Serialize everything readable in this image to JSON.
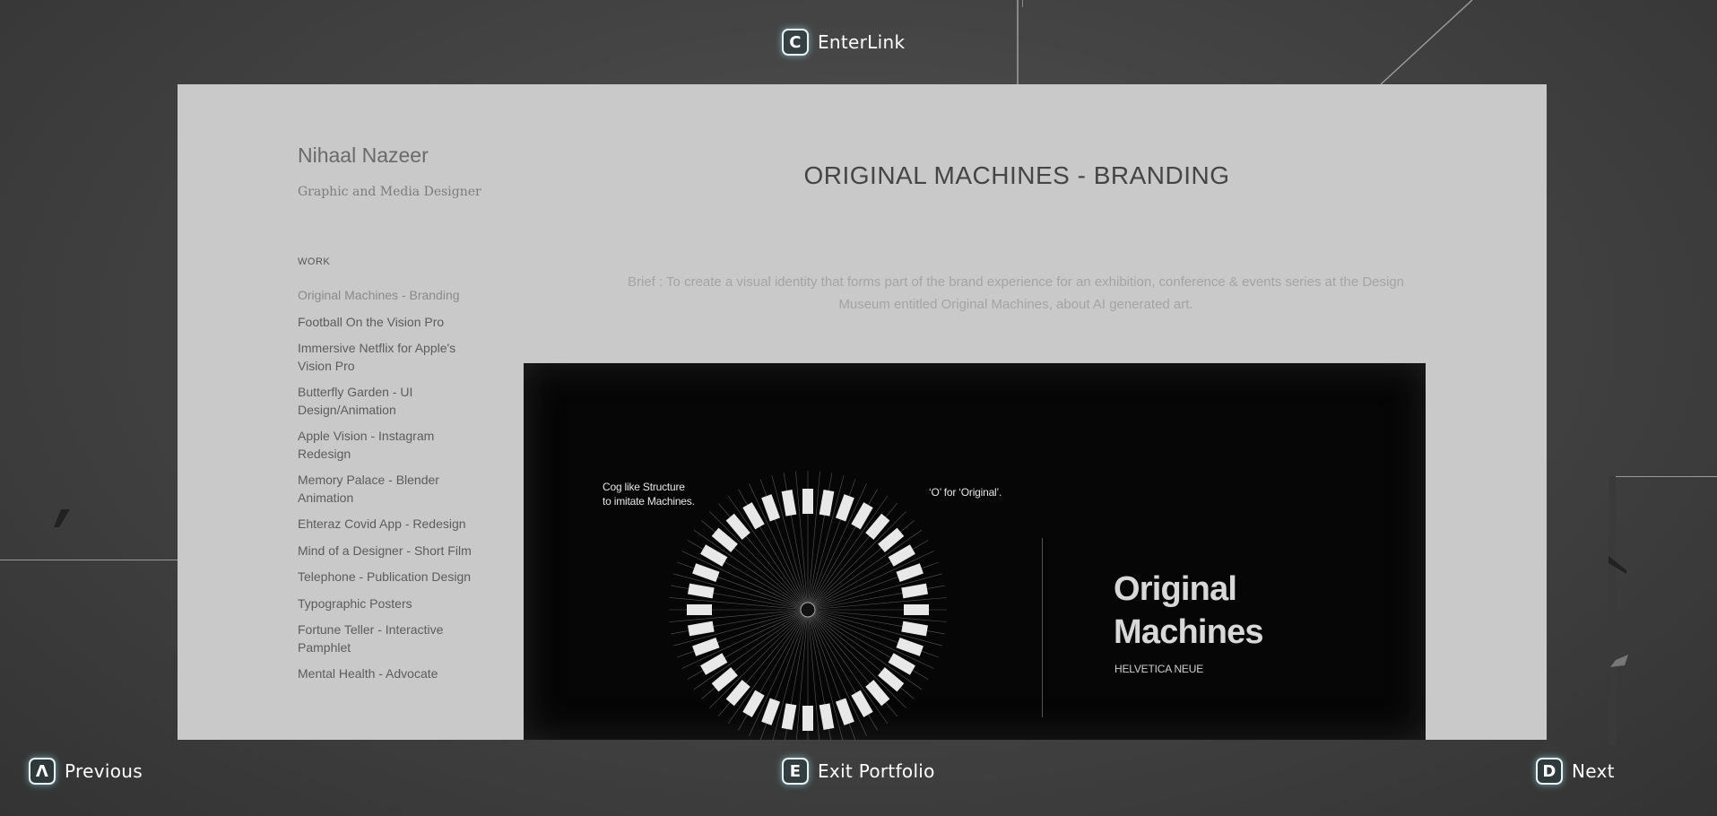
{
  "overlay": {
    "top": {
      "key": "C",
      "label": "EnterLink"
    },
    "bottom_left": {
      "key": "Λ",
      "label": "Previous"
    },
    "bottom_center": {
      "key": "E",
      "label": "Exit Portfolio"
    },
    "bottom_right": {
      "key": "D",
      "label": "Next"
    }
  },
  "site": {
    "name": "Nihaal Nazeer",
    "subtitle": "Graphic and Media Designer",
    "nav_heading": "WORK",
    "nav_items": [
      "Original Machines - Branding",
      "Football On the Vision Pro",
      "Immersive Netflix for Apple's Vision Pro",
      "Butterfly Garden - UI Design/Animation",
      "Apple Vision - Instagram Redesign",
      "Memory Palace - Blender Animation",
      "Ehteraz Covid App - Redesign",
      "Mind of a Designer - Short Film",
      "Telephone - Publication Design",
      "Typographic Posters",
      "Fortune Teller - Interactive Pamphlet",
      "Mental Health - Advocate"
    ],
    "active_index": 0
  },
  "project": {
    "title": "ORIGINAL MACHINES - BRANDING",
    "brief": "Brief : To create a visual identity that forms part of the brand experience for an exhibition, conference & events series at the Design Museum entitled Original Machines, about AI generated art.",
    "hero": {
      "caption_cog": "Cog like Structure\nto imitate Machines.",
      "caption_o": "‘O’ for ‘Original’.",
      "brand_title_line1": "Original",
      "brand_title_line2": "Machines",
      "brand_font": "HELVETICA NEUE"
    }
  }
}
